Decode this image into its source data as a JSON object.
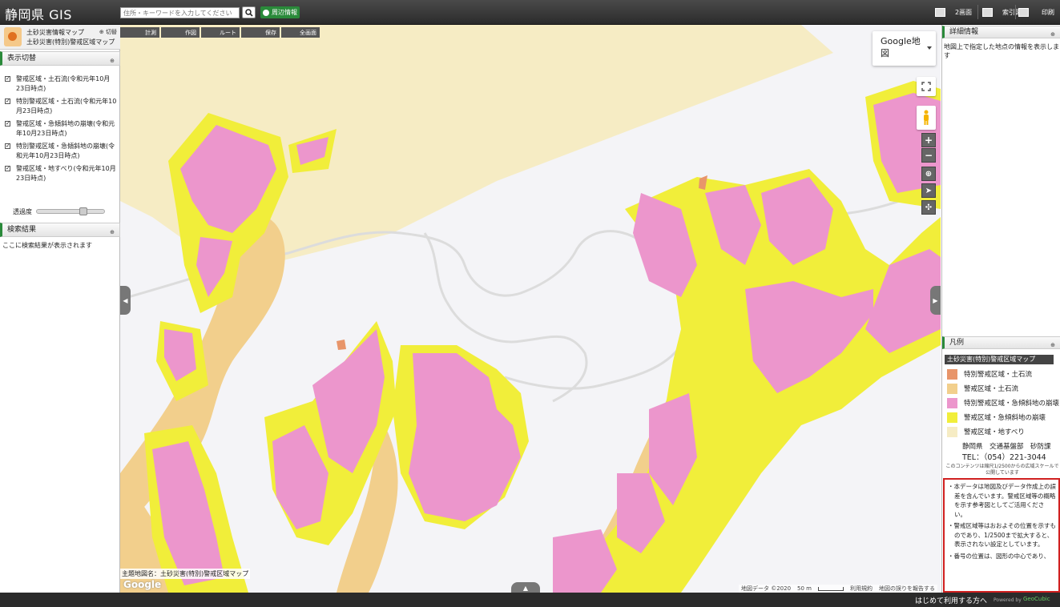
{
  "header": {
    "app_title": "静岡県 GIS",
    "search_placeholder": "住所・キーワードを入力してください",
    "nearby_label": "周辺情報",
    "two_screen_label": "2画面",
    "index_label": "索引図",
    "print_label": "印刷"
  },
  "left_panel": {
    "map_title_1": "土砂災害情報マップ",
    "map_title_2": "土砂災害(特別)警戒区域マップ",
    "switch_label": "切替",
    "display_section": "表示切替",
    "layers": [
      {
        "label": "警戒区域・土石流(令和元年10月23日時点)",
        "checked": true
      },
      {
        "label": "特別警戒区域・土石流(令和元年10月23日時点)",
        "checked": true
      },
      {
        "label": "警戒区域・急傾斜地の崩壊(令和元年10月23日時点)",
        "checked": true
      },
      {
        "label": "特別警戒区域・急傾斜地の崩壊(令和元年10月23日時点)",
        "checked": true
      },
      {
        "label": "警戒区域・地すべり(令和元年10月23日時点)",
        "checked": true
      }
    ],
    "opacity_label": "透過度",
    "opacity_value": 0.7,
    "results_section": "検索結果",
    "results_text": "ここに検索結果が表示されます"
  },
  "map": {
    "toolbar": [
      "計測",
      "作図",
      "ルート",
      "保存",
      "全画面"
    ],
    "map_type": "Google地図",
    "theme_label": "主題地図名：土砂災害(特別)警戒区域マップ",
    "google_logo": "Google",
    "attribution": "地図データ ©2020",
    "scale": "50 m",
    "terms": "利用規約",
    "report": "地図の誤りを報告する"
  },
  "right_panel": {
    "detail_section": "詳細情報",
    "detail_text": "地図上で指定した地点の情報を表示します",
    "legend_section": "凡例",
    "legend_title": "土砂災害(特別)警戒区域マップ",
    "legend_items": [
      {
        "label": "特別警戒区域・土石流",
        "color": "#e8956a"
      },
      {
        "label": "警戒区域・土石流",
        "color": "#f2cf8c"
      },
      {
        "label": "特別警戒区域・急傾斜地の崩壊",
        "color": "#ec96cc"
      },
      {
        "label": "警戒区域・急傾斜地の崩壊",
        "color": "#f1ee3a"
      },
      {
        "label": "警戒区域・地すべり",
        "color": "#f6ecc4"
      }
    ],
    "org_name": "静岡県　交通基盤部　砂防課",
    "tel": "TEL：（054）221-3044",
    "scale_note": "このコンテンツは縮尺1/2500からの広域スケールで公開しています",
    "disclaimers": [
      "・本データは地図及びデータ作成上の誤差を含んでいます。警戒区域等の概略を示す参考図としてご活用ください。",
      "・警戒区域等はおおよその位置を示すものであり、1/2500まで拡大すると、表示されない設定としています。",
      "・番号の位置は、図形の中心であり、"
    ]
  },
  "footer": {
    "first_use": "はじめて利用する方へ",
    "powered": "Powered by",
    "geocubic": "GeoCubic"
  }
}
